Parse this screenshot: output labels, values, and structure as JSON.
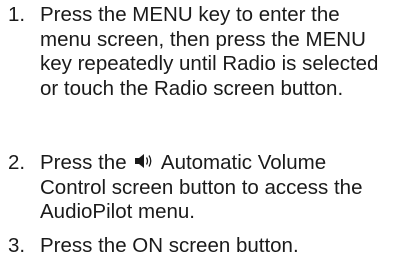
{
  "steps": [
    {
      "number": "1.",
      "text": "Press the MENU key to enter the menu screen, then press the MENU key repeatedly until Radio is selected or touch the Radio screen button."
    },
    {
      "number": "2.",
      "text_before_icon": "Press the",
      "icon": "speaker-volume-icon",
      "text_after_icon": "Automatic Volume Control screen button to access the AudioPilot menu."
    },
    {
      "number": "3.",
      "text": "Press the ON screen button."
    }
  ]
}
